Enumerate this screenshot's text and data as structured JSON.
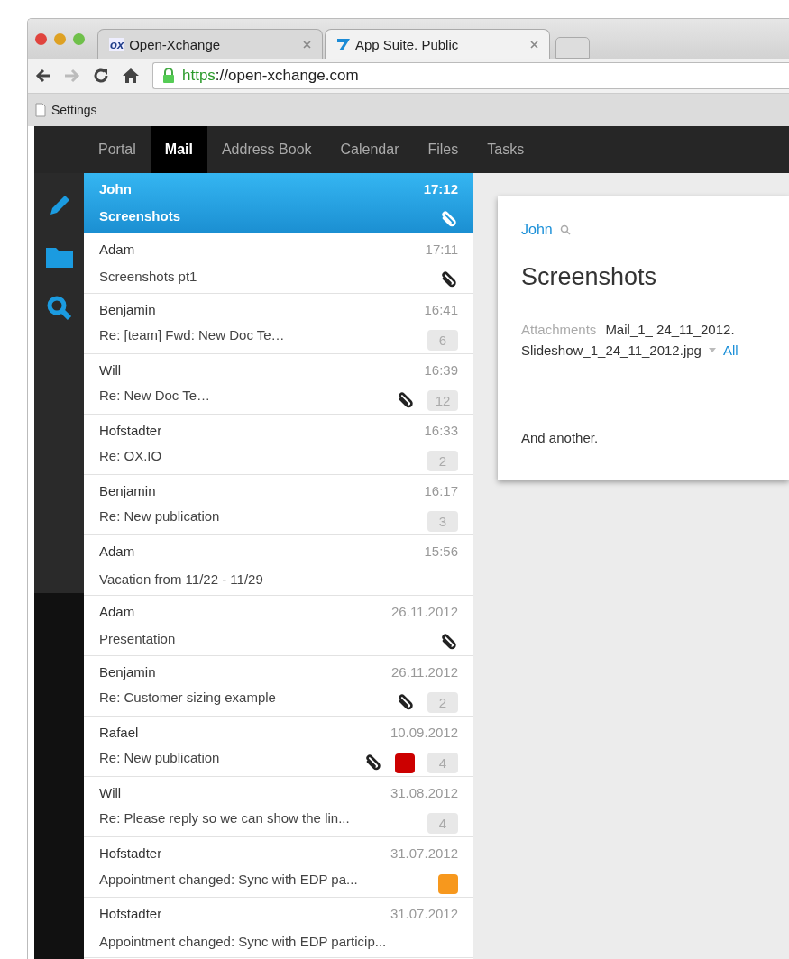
{
  "browser": {
    "tabs": [
      {
        "title": "Open-Xchange",
        "logo_text": "ox",
        "selected": false
      },
      {
        "title": "App Suite. Public",
        "selected": true
      }
    ],
    "url_scheme": "https",
    "url_rest": "://open-xchange.com",
    "bookmarks": [
      "Settings"
    ]
  },
  "app_nav": [
    {
      "label": "Portal",
      "selected": false
    },
    {
      "label": "Mail",
      "selected": true
    },
    {
      "label": "Address Book",
      "selected": false
    },
    {
      "label": "Calendar",
      "selected": false
    },
    {
      "label": "Files",
      "selected": false
    },
    {
      "label": "Tasks",
      "selected": false
    }
  ],
  "mail_list": [
    {
      "from": "John",
      "time": "17:12",
      "subject": "Screenshots",
      "attachment": true,
      "selected": true
    },
    {
      "from": "Adam",
      "time": "17:11",
      "subject": "Screenshots pt1",
      "attachment": true,
      "selected": false
    },
    {
      "from": "Benjamin",
      "time": "16:41",
      "subject": "Re: [team] Fwd: New Doc Te…",
      "attachment": false,
      "count": "6",
      "selected": false
    },
    {
      "from": "Will",
      "time": "16:39",
      "subject": "Re: New Doc Te…",
      "attachment": true,
      "count": "12",
      "selected": false
    },
    {
      "from": "Hofstadter",
      "time": "16:33",
      "subject": "Re: OX.IO",
      "attachment": false,
      "count": "2",
      "selected": false
    },
    {
      "from": "Benjamin",
      "time": "16:17",
      "subject": "Re: New publication",
      "attachment": false,
      "count": "3",
      "selected": false
    },
    {
      "from": "Adam",
      "time": "15:56",
      "subject": "Vacation from 11/22 - 11/29",
      "attachment": false,
      "selected": false
    },
    {
      "from": "Adam",
      "time": "26.11.2012",
      "subject": "Presentation",
      "attachment": true,
      "selected": false
    },
    {
      "from": "Benjamin",
      "time": "26.11.2012",
      "subject": "Re: Customer sizing example",
      "attachment": true,
      "count": "2",
      "selected": false
    },
    {
      "from": "Rafael",
      "time": "10.09.2012",
      "subject": "Re: New publication",
      "attachment": true,
      "color": "#cc0000",
      "count": "4",
      "selected": false
    },
    {
      "from": "Will",
      "time": "31.08.2012",
      "subject": "Re: Please reply so we can show the lin...",
      "attachment": false,
      "count": "4",
      "selected": false
    },
    {
      "from": "Hofstadter",
      "time": "31.07.2012",
      "subject": "Appointment changed: Sync with EDP pa...",
      "attachment": false,
      "color": "#f7981d",
      "selected": false
    },
    {
      "from": "Hofstadter",
      "time": "31.07.2012",
      "subject": "Appointment changed: Sync with EDP particip...",
      "attachment": false,
      "selected": false
    }
  ],
  "detail": {
    "sender": "John",
    "subject": "Screenshots",
    "attachments_label": "Attachments",
    "attachments": [
      "Mail_1_ 24_11_2012.",
      "Slideshow_1_24_11_2012.jpg"
    ],
    "all_link": "All",
    "body": "And another."
  }
}
